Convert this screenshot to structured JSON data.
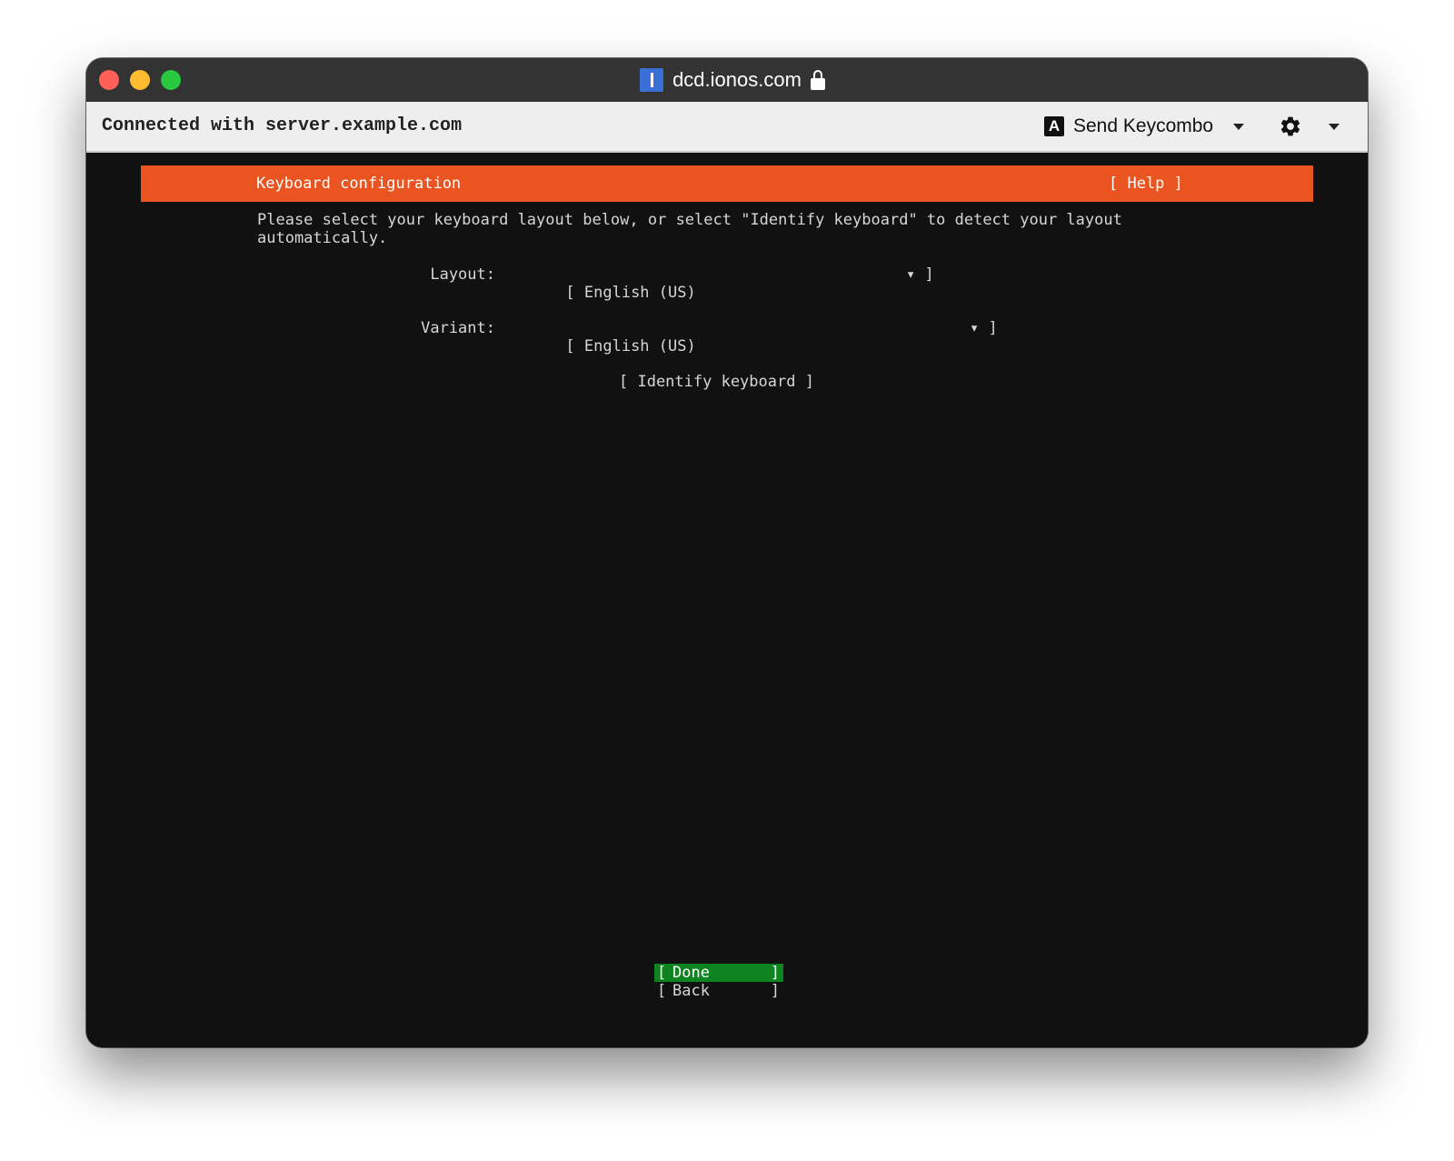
{
  "window": {
    "title": "dcd.ionos.com"
  },
  "toolbar": {
    "connection_text": "Connected with server.example.com",
    "keycombo_icon_letter": "A",
    "keycombo_label": "Send Keycombo"
  },
  "installer": {
    "title": "Keyboard configuration",
    "help_label": "[ Help ]",
    "instructions": "Please select your keyboard layout below, or select \"Identify keyboard\" to detect your layout\nautomatically.",
    "layout": {
      "label": "Layout:",
      "value": "[ English (US)",
      "suffix": "▾ ]"
    },
    "variant": {
      "label": "Variant:",
      "value": "[ English (US)",
      "suffix": "▾ ]"
    },
    "identify_button": "[ Identify keyboard ]",
    "footer": {
      "done_label": "Done",
      "back_label": "Back",
      "bracket_open": "[",
      "bracket_close": "]"
    }
  },
  "colors": {
    "header_accent": "#e95420",
    "focused_button": "#0e8420",
    "console_background": "#111111"
  },
  "icons": [
    "close-icon",
    "minimize-icon",
    "maximize-icon",
    "site-favicon-icon",
    "lock-icon",
    "keyboard-a-icon",
    "chevron-down-icon",
    "gear-icon"
  ]
}
